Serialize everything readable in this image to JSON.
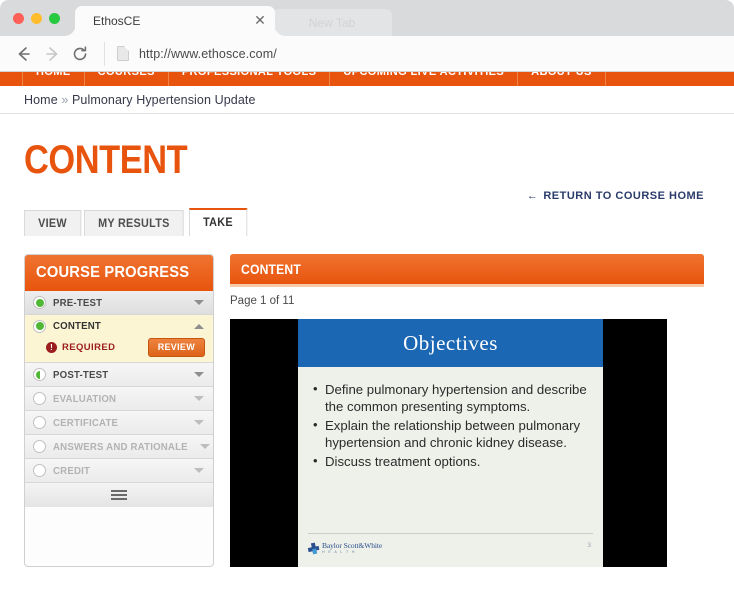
{
  "browser": {
    "tab": {
      "title": "EthosCE",
      "close_icon": "close-icon"
    },
    "ghost_tab": {
      "title": "New Tab"
    },
    "toolbar": {
      "back_icon": "back-arrow-icon",
      "forward_icon": "forward-arrow-icon",
      "reload_icon": "reload-icon",
      "favicon": "page-document-icon",
      "url": "http://www.ethosce.com/"
    },
    "window_controls": {
      "close": "close-window-dot",
      "minimize": "minimize-window-dot",
      "maximize": "maximize-window-dot"
    }
  },
  "site": {
    "nav": [
      {
        "label": "HOME"
      },
      {
        "label": "COURSES"
      },
      {
        "label": "PROFESSIONAL TOOLS"
      },
      {
        "label": "UPCOMING LIVE ACTIVITIES"
      },
      {
        "label": "ABOUT US"
      }
    ],
    "breadcrumb": {
      "home": "Home",
      "separator": "»",
      "current": "Pulmonary Hypertension Update"
    },
    "page_title": "CONTENT",
    "return_link": {
      "arrow": "←",
      "label": "RETURN TO COURSE HOME"
    },
    "tabs": [
      {
        "label": "VIEW",
        "active": false
      },
      {
        "label": "MY RESULTS",
        "active": false
      },
      {
        "label": "TAKE",
        "active": true
      }
    ]
  },
  "sidebar": {
    "title": "COURSE PROGRESS",
    "items": [
      {
        "label": "PRE-TEST",
        "state": "complete",
        "caret": "down"
      },
      {
        "label": "CONTENT",
        "state": "complete",
        "caret": "up",
        "current": true
      },
      {
        "label": "POST-TEST",
        "state": "partial",
        "caret": "down"
      },
      {
        "label": "EVALUATION",
        "state": "empty",
        "caret": "down"
      },
      {
        "label": "CERTIFICATE",
        "state": "empty",
        "caret": "down"
      },
      {
        "label": "ANSWERS AND RATIONALE",
        "state": "empty",
        "caret": "down"
      },
      {
        "label": "CREDIT",
        "state": "empty",
        "caret": "down"
      }
    ],
    "current_detail": {
      "required_icon": "!",
      "required_label": "REQUIRED",
      "review_button": "REVIEW"
    },
    "footer_icon": "hamburger-menu-icon"
  },
  "content_panel": {
    "title": "CONTENT",
    "page_count": "Page 1 of 11",
    "slide": {
      "title": "Objectives",
      "bullets": [
        "Define pulmonary hypertension and describe the common presenting symptoms.",
        "Explain the relationship between pulmonary hypertension and chronic kidney disease.",
        "Discuss treatment options."
      ],
      "footer_logo": {
        "name": "Baylor Scott&White",
        "sub": "H E A L T H",
        "icon": "baylor-cross-icon"
      },
      "slide_number": "3"
    }
  },
  "colors": {
    "brand_orange": "#e8540e",
    "orange_light": "#ef7430",
    "slide_blue": "#1c67b3",
    "required_red": "#9b1d1d",
    "progress_green": "#52b734",
    "highlight_yellow": "#fcf5d4",
    "link_navy": "#2b3b6b"
  }
}
